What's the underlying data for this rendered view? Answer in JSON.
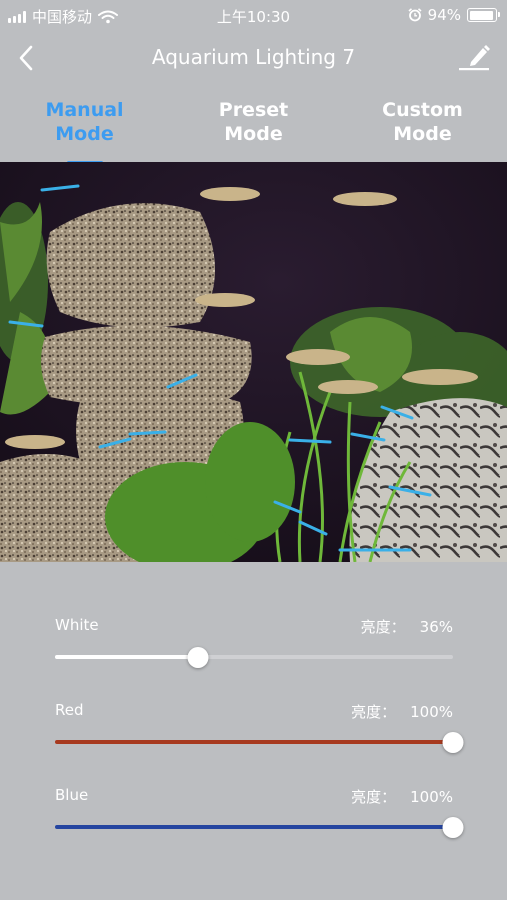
{
  "status_bar": {
    "carrier": "中国移动",
    "time": "上午10:30",
    "battery_text": "94%",
    "battery_level": 0.94,
    "icons": [
      "signal-icon",
      "wifi-icon",
      "alarm-icon",
      "battery-icon"
    ]
  },
  "nav": {
    "title": "Aquarium Lighting 7",
    "back_icon": "chevron-left-icon",
    "edit_icon": "edit-pencil-icon"
  },
  "tabs": [
    {
      "line1": "Manual",
      "line2": "Mode",
      "active": true
    },
    {
      "line1": "Preset",
      "line2": "Mode",
      "active": false
    },
    {
      "line1": "Custom",
      "line2": "Mode",
      "active": false
    }
  ],
  "colors": {
    "accent": "#3d9cf0",
    "background": "#bcbec1",
    "white_channel": "#ffffff",
    "red_channel": "#a73a1f",
    "blue_channel": "#2545a0"
  },
  "channels": [
    {
      "name": "White",
      "brightness_label": "亮度：",
      "value_text": "36%",
      "level": 0.36
    },
    {
      "name": "Red",
      "brightness_label": "亮度：",
      "value_text": "100%",
      "level": 1.0
    },
    {
      "name": "Blue",
      "brightness_label": "亮度：",
      "value_text": "100%",
      "level": 1.0
    }
  ]
}
